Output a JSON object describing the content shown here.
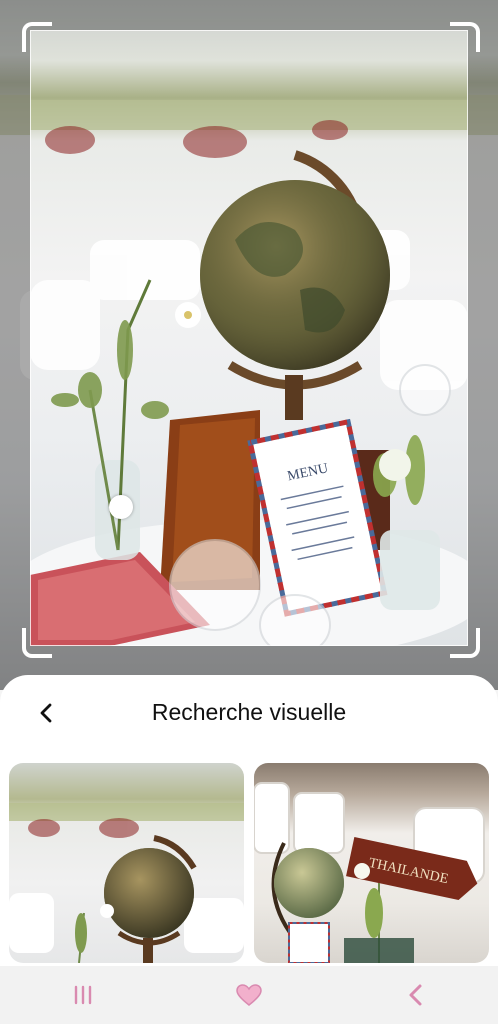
{
  "sheet": {
    "title": "Recherche visuelle",
    "back_icon": "chevron-left-icon"
  },
  "photo": {
    "menu_card": {
      "heading": "MENU"
    }
  },
  "results": [
    {
      "name": "globe-centerpiece-photo"
    },
    {
      "name": "thailand-globe-centerpiece-photo",
      "sign_text": "THAILANDE"
    }
  ],
  "navbar": {
    "recent_icon": "recent-apps-icon",
    "home_icon": "home-heart-icon",
    "back_icon": "back-arrow-icon"
  },
  "colors": {
    "sheet_bg": "#ffffff",
    "nav_bg": "#f2f2f2",
    "nav_icon": "#d98ab0"
  }
}
